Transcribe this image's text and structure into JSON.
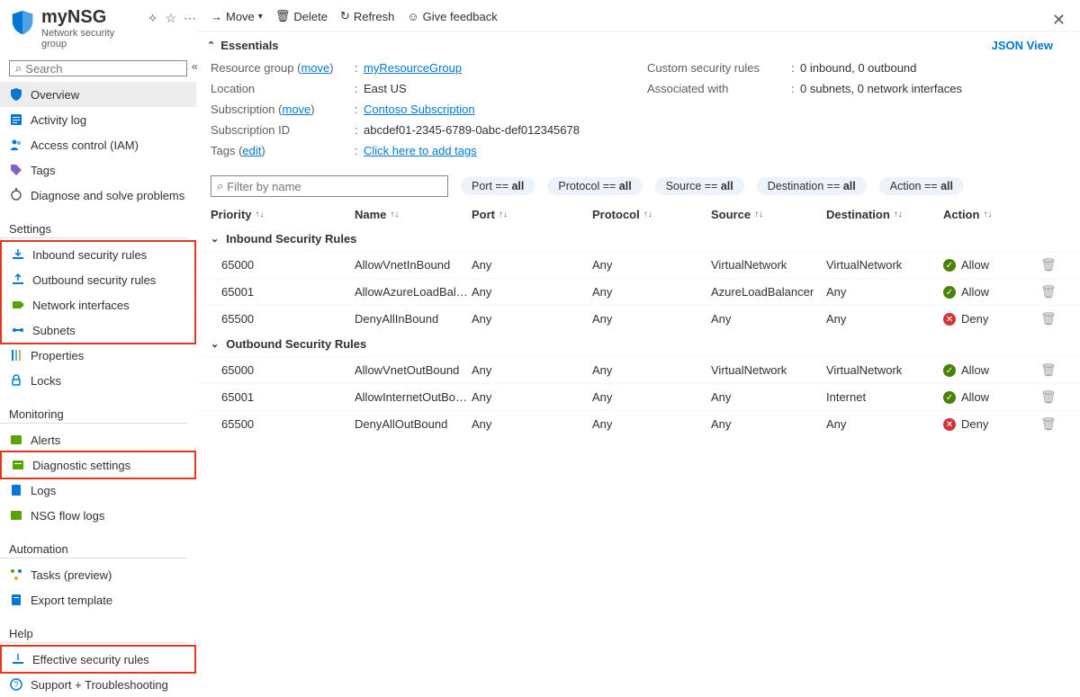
{
  "header": {
    "title": "myNSG",
    "subtitle": "Network security group"
  },
  "search": {
    "placeholder": "Search"
  },
  "nav": {
    "top": [
      {
        "id": "overview",
        "label": "Overview",
        "selected": true
      },
      {
        "id": "activity",
        "label": "Activity log"
      },
      {
        "id": "iam",
        "label": "Access control (IAM)"
      },
      {
        "id": "tags",
        "label": "Tags"
      },
      {
        "id": "diagnose",
        "label": "Diagnose and solve problems"
      }
    ],
    "settings_label": "Settings",
    "settings": [
      {
        "id": "inbound",
        "label": "Inbound security rules",
        "hl": true
      },
      {
        "id": "outbound",
        "label": "Outbound security rules",
        "hl": true
      },
      {
        "id": "nic",
        "label": "Network interfaces",
        "hl": true
      },
      {
        "id": "subnets",
        "label": "Subnets",
        "hl": true
      },
      {
        "id": "properties",
        "label": "Properties"
      },
      {
        "id": "locks",
        "label": "Locks"
      }
    ],
    "monitoring_label": "Monitoring",
    "monitoring": [
      {
        "id": "alerts",
        "label": "Alerts"
      },
      {
        "id": "diag",
        "label": "Diagnostic settings",
        "hl": true
      },
      {
        "id": "logs",
        "label": "Logs"
      },
      {
        "id": "flow",
        "label": "NSG flow logs"
      }
    ],
    "automation_label": "Automation",
    "automation": [
      {
        "id": "tasks",
        "label": "Tasks (preview)"
      },
      {
        "id": "export",
        "label": "Export template"
      }
    ],
    "help_label": "Help",
    "help": [
      {
        "id": "effective",
        "label": "Effective security rules",
        "hl": true
      },
      {
        "id": "support",
        "label": "Support + Troubleshooting"
      }
    ]
  },
  "toolbar": {
    "move": "Move",
    "delete": "Delete",
    "refresh": "Refresh",
    "feedback": "Give feedback"
  },
  "essentials": {
    "label": "Essentials",
    "jsonview": "JSON View",
    "left": [
      {
        "label": "Resource group (",
        "move": "move",
        "suffix": ")",
        "value": "myResourceGroup",
        "link": true
      },
      {
        "label": "Location",
        "value": "East US"
      },
      {
        "label": "Subscription (",
        "move": "move",
        "suffix": ")",
        "value": "Contoso Subscription",
        "link": true
      },
      {
        "label": "Subscription ID",
        "value": "abcdef01-2345-6789-0abc-def012345678"
      },
      {
        "label": "Tags (",
        "move": "edit",
        "suffix": ")",
        "value": "Click here to add tags",
        "link": true
      }
    ],
    "right": [
      {
        "label": "Custom security rules",
        "value": "0 inbound, 0 outbound"
      },
      {
        "label": "Associated with",
        "value": "0 subnets, 0 network interfaces"
      }
    ]
  },
  "filter": {
    "placeholder": "Filter by name",
    "pills": [
      {
        "key": "Port",
        "val": "all"
      },
      {
        "key": "Protocol",
        "val": "all"
      },
      {
        "key": "Source",
        "val": "all"
      },
      {
        "key": "Destination",
        "val": "all"
      },
      {
        "key": "Action",
        "val": "all"
      }
    ]
  },
  "columns": [
    "Priority",
    "Name",
    "Port",
    "Protocol",
    "Source",
    "Destination",
    "Action"
  ],
  "groups": [
    {
      "title": "Inbound Security Rules",
      "rows": [
        {
          "pri": "65000",
          "name": "AllowVnetInBound",
          "port": "Any",
          "prot": "Any",
          "src": "VirtualNetwork",
          "dst": "VirtualNetwork",
          "act": "Allow"
        },
        {
          "pri": "65001",
          "name": "AllowAzureLoadBalanc…",
          "port": "Any",
          "prot": "Any",
          "src": "AzureLoadBalancer",
          "dst": "Any",
          "act": "Allow"
        },
        {
          "pri": "65500",
          "name": "DenyAllInBound",
          "port": "Any",
          "prot": "Any",
          "src": "Any",
          "dst": "Any",
          "act": "Deny"
        }
      ]
    },
    {
      "title": "Outbound Security Rules",
      "rows": [
        {
          "pri": "65000",
          "name": "AllowVnetOutBound",
          "port": "Any",
          "prot": "Any",
          "src": "VirtualNetwork",
          "dst": "VirtualNetwork",
          "act": "Allow"
        },
        {
          "pri": "65001",
          "name": "AllowInternetOutBound",
          "port": "Any",
          "prot": "Any",
          "src": "Any",
          "dst": "Internet",
          "act": "Allow"
        },
        {
          "pri": "65500",
          "name": "DenyAllOutBound",
          "port": "Any",
          "prot": "Any",
          "src": "Any",
          "dst": "Any",
          "act": "Deny"
        }
      ]
    }
  ]
}
